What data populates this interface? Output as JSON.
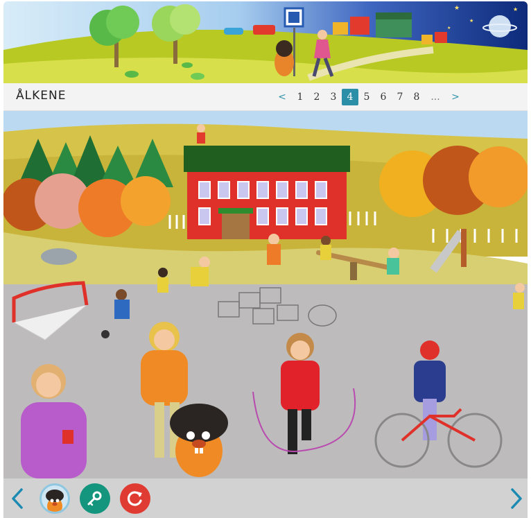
{
  "header": {
    "page_title": "ÅLKENE"
  },
  "pagination": {
    "prev_label": "<",
    "next_label": ">",
    "pages": [
      "1",
      "2",
      "3",
      "4",
      "5",
      "6",
      "7",
      "8"
    ],
    "current_page": "4",
    "ellipsis": "..."
  },
  "colors": {
    "accent": "#2a8fa7",
    "key_button": "#14957e",
    "reload_button": "#e03b32",
    "toolbar_bg": "#d2d2d2"
  },
  "toolbar": {
    "prev_icon": "chevron-left-icon",
    "avatar_icon": "mole-mascot-icon",
    "key_icon": "key-icon",
    "reload_icon": "reload-icon",
    "next_icon": "chevron-right-icon"
  }
}
